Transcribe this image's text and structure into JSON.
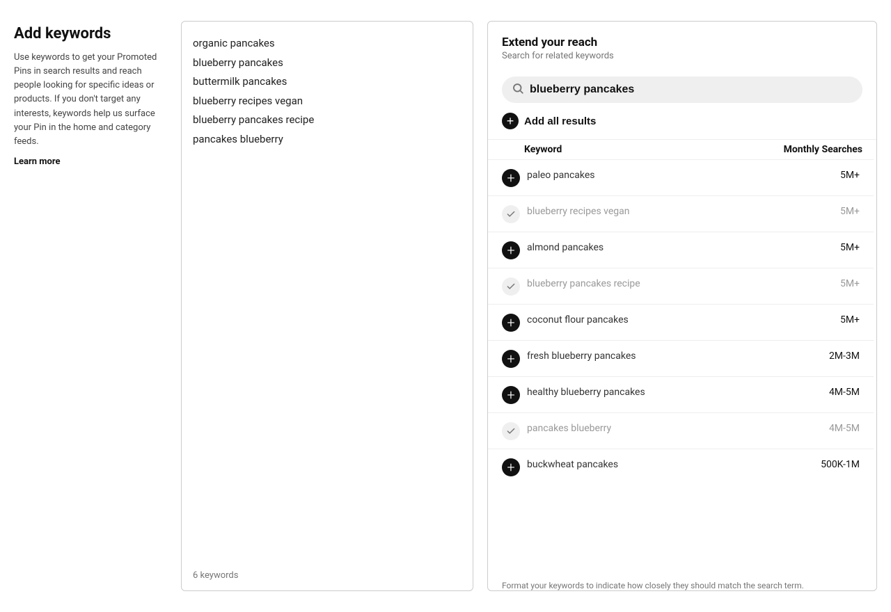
{
  "left": {
    "title": "Add keywords",
    "description": "Use keywords to get your Promoted Pins in search results and reach people looking for specific ideas or products. If you don't target any interests, keywords help us surface your Pin in the home and category feeds.",
    "learn_more": "Learn more"
  },
  "middle": {
    "keywords": [
      "organic pancakes",
      "blueberry pancakes",
      "buttermilk pancakes",
      "blueberry recipes vegan",
      "blueberry pancakes recipe",
      "pancakes blueberry"
    ],
    "count_label": "6 keywords"
  },
  "right": {
    "title": "Extend your reach",
    "subtitle": "Search for related keywords",
    "search_value": "blueberry pancakes",
    "search_placeholder": "blueberry pancakes",
    "add_all_label": "Add all results",
    "table_header": {
      "keyword": "Keyword",
      "searches": "Monthly Searches"
    },
    "results": [
      {
        "keyword": "paleo pancakes",
        "searches": "5M+",
        "state": "add"
      },
      {
        "keyword": "blueberry recipes vegan",
        "searches": "5M+",
        "state": "added"
      },
      {
        "keyword": "almond pancakes",
        "searches": "5M+",
        "state": "add"
      },
      {
        "keyword": "blueberry pancakes recipe",
        "searches": "5M+",
        "state": "added"
      },
      {
        "keyword": "coconut flour pancakes",
        "searches": "5M+",
        "state": "add"
      },
      {
        "keyword": "fresh blueberry pancakes",
        "searches": "2M-3M",
        "state": "add"
      },
      {
        "keyword": "healthy blueberry pancakes",
        "searches": "4M-5M",
        "state": "add"
      },
      {
        "keyword": "pancakes blueberry",
        "searches": "4M-5M",
        "state": "added"
      },
      {
        "keyword": "buckwheat pancakes",
        "searches": "500K-1M",
        "state": "add"
      }
    ],
    "bottom_hint": "Format your keywords to indicate how closely they should match the search term."
  }
}
